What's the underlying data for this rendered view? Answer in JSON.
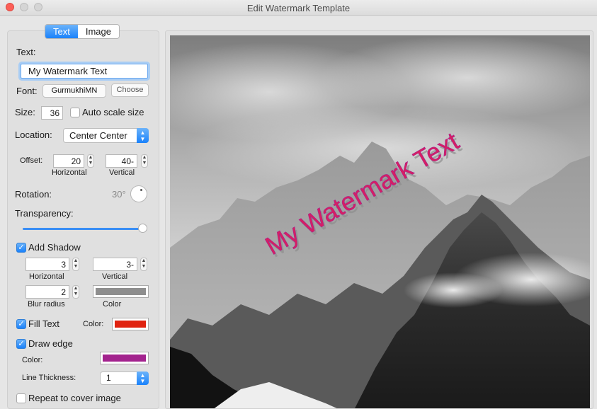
{
  "window": {
    "title": "Edit Watermark Template"
  },
  "tabs": [
    {
      "label": "Text",
      "active": true
    },
    {
      "label": "Image",
      "active": false
    }
  ],
  "text": {
    "label": "Text:",
    "value": "My Watermark Text"
  },
  "font": {
    "label": "Font:",
    "value": "GurmukhiMN",
    "choose_label": "Choose"
  },
  "size": {
    "label": "Size:",
    "value": "36",
    "auto_scale_label": "Auto scale size",
    "auto_scale_checked": false
  },
  "location": {
    "label": "Location:",
    "value": "Center Center"
  },
  "offset": {
    "label": "Offset:",
    "horizontal_value": "20",
    "vertical_value": "40-",
    "horizontal_label": "Horizontal",
    "vertical_label": "Vertical"
  },
  "rotation": {
    "label": "Rotation:",
    "value": "30°"
  },
  "transparency": {
    "label": "Transparency:",
    "level": 1.0
  },
  "shadow": {
    "label": "Add Shadow",
    "checked": true,
    "horizontal_value": "3",
    "vertical_value": "3-",
    "horizontal_label": "Horizontal",
    "vertical_label": "Vertical",
    "blur_value": "2",
    "blur_label": "Blur radius",
    "color_label": "Color",
    "color": "#8e8e8e"
  },
  "fill": {
    "label": "Fill Text",
    "checked": true,
    "color_label": "Color:",
    "color": "#e0220f"
  },
  "edge": {
    "label": "Draw edge",
    "checked": true,
    "color_label": "Color:",
    "color": "#a3238e",
    "thickness_label": "Line Thickness:",
    "thickness_value": "1"
  },
  "repeat": {
    "label": "Repeat to cover image",
    "checked": false
  },
  "preview": {
    "watermark_text": "My Watermark Text",
    "watermark_color": "#d81e62"
  },
  "colors": {
    "accent": "#1a82fb"
  }
}
